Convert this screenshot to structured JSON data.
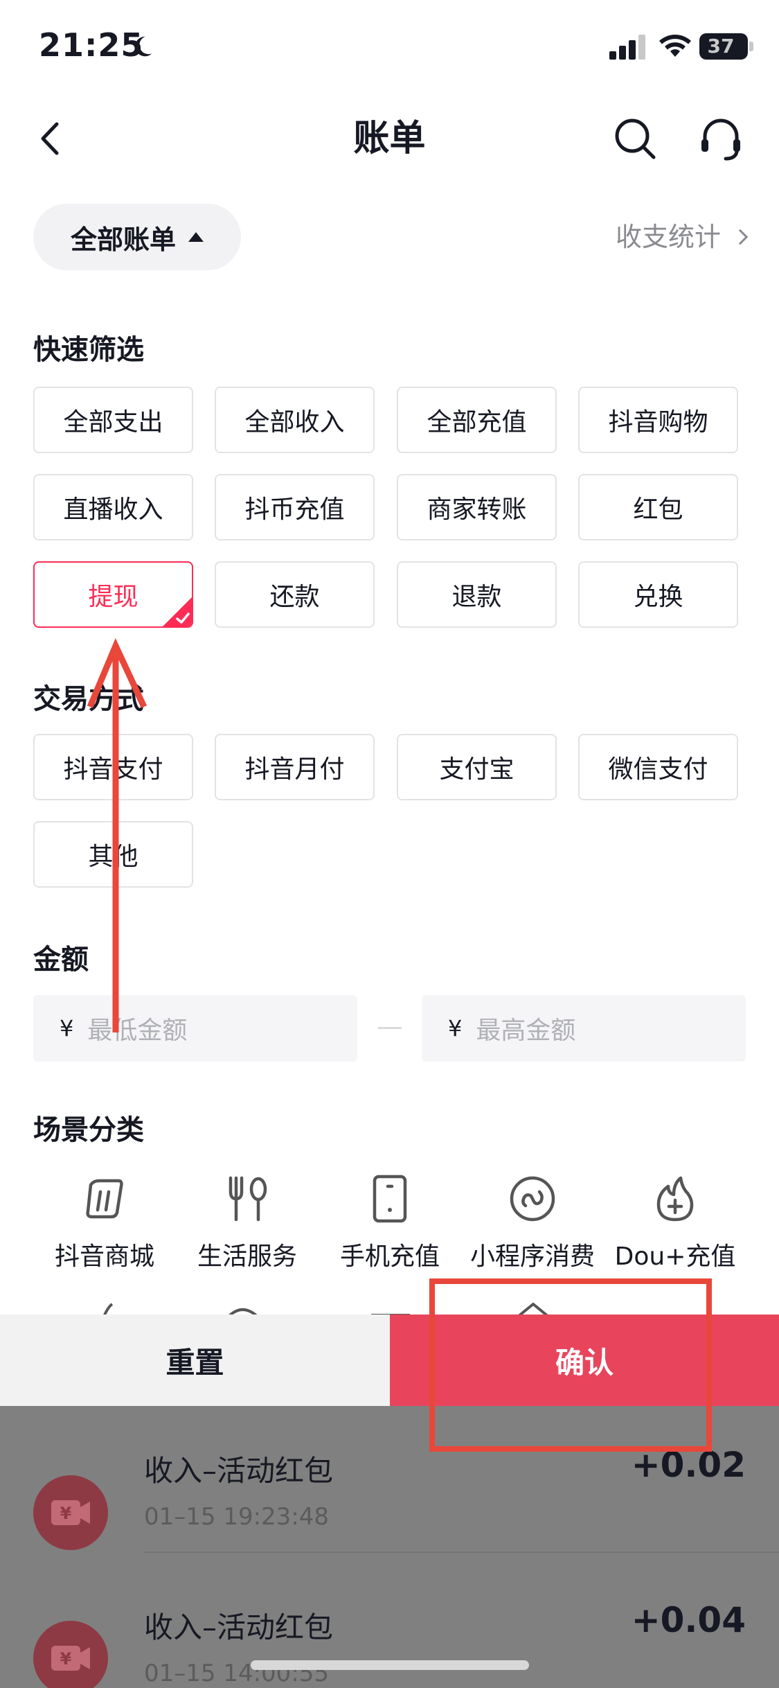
{
  "status": {
    "time": "21:25",
    "battery": "37",
    "battery_level": 0.37
  },
  "nav": {
    "title": "账单"
  },
  "filter_bar": {
    "dropdown_label": "全部账单",
    "stats_label": "收支统计"
  },
  "quick_filter": {
    "title": "快速筛选",
    "chips": [
      "全部支出",
      "全部收入",
      "全部充值",
      "抖音购物",
      "直播收入",
      "抖币充值",
      "商家转账",
      "红包",
      "提现",
      "还款",
      "退款",
      "兑换"
    ],
    "selected": "提现"
  },
  "payment_method": {
    "title": "交易方式",
    "chips": [
      "抖音支付",
      "抖音月付",
      "支付宝",
      "微信支付",
      "其他"
    ]
  },
  "amount": {
    "title": "金额",
    "currency": "¥",
    "min_placeholder": "最低金额",
    "max_placeholder": "最高金额"
  },
  "scene": {
    "title": "场景分类",
    "items": [
      {
        "label": "抖音商城",
        "icon": "mall-icon"
      },
      {
        "label": "生活服务",
        "icon": "cutlery-icon"
      },
      {
        "label": "手机充值",
        "icon": "phone-icon"
      },
      {
        "label": "小程序消费",
        "icon": "mini-program-icon"
      },
      {
        "label": "Dou+充值",
        "icon": "flame-plus-icon"
      }
    ]
  },
  "actions": {
    "reset": "重置",
    "confirm": "确认"
  },
  "transactions": [
    {
      "title": "收入–活动红包",
      "time": "01–15 19:23:48",
      "amount": "+0.02"
    },
    {
      "title": "收入–活动红包",
      "time": "01–15 14:00:55",
      "amount": "+0.04"
    }
  ],
  "colors": {
    "accent": "#fe2c55",
    "confirm_bg": "#e8455d",
    "annotation": "#e8473a"
  }
}
